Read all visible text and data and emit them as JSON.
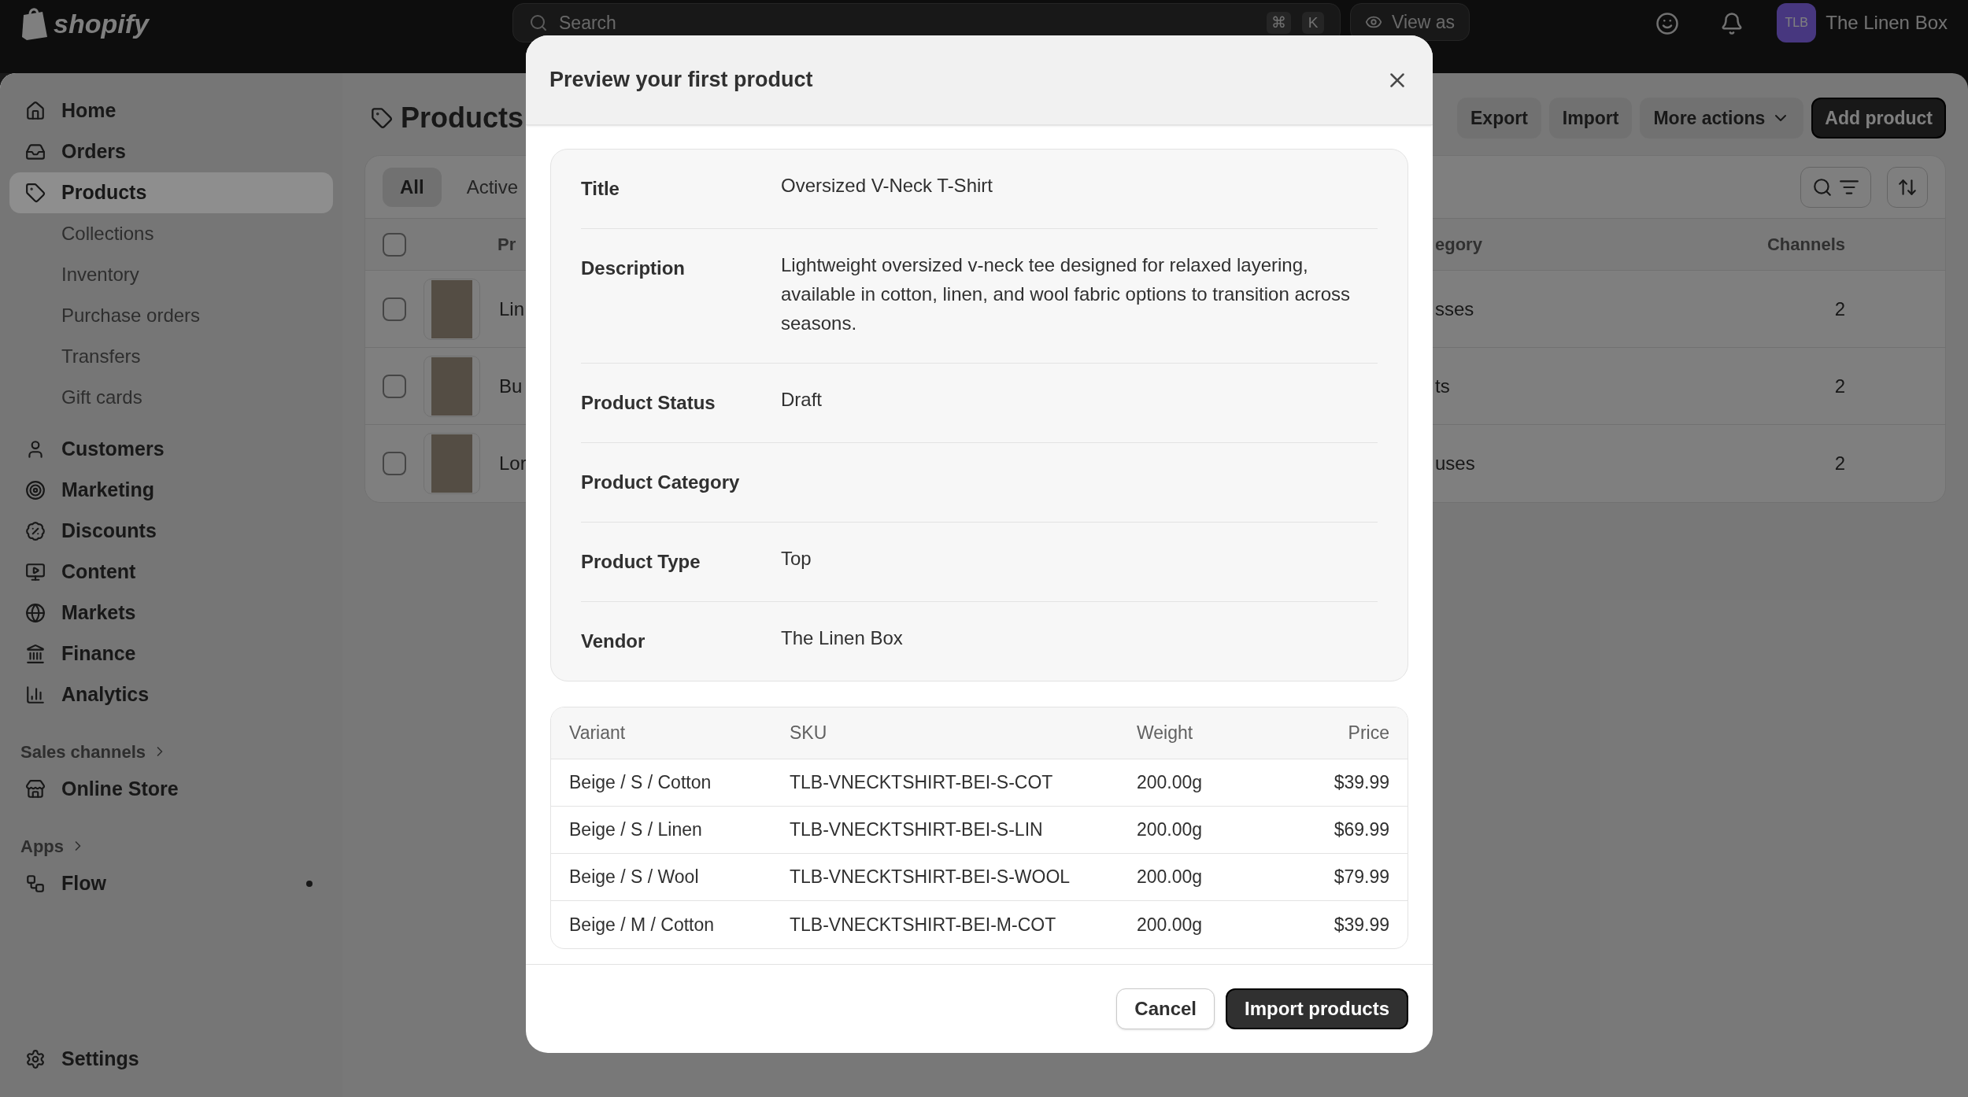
{
  "top_bar": {
    "logo_text": "shopify",
    "search": {
      "placeholder": "Search",
      "keys": [
        "⌘",
        "K"
      ]
    },
    "view_as": "View as",
    "store": {
      "initials": "TLB",
      "name": "The Linen Box"
    }
  },
  "sidebar": {
    "sections": [
      {
        "items": [
          {
            "label": "Home",
            "selected": false
          },
          {
            "label": "Orders",
            "selected": false
          },
          {
            "label": "Products",
            "selected": true,
            "children": [
              {
                "label": "Collections",
                "selected": false
              },
              {
                "label": "Inventory",
                "selected": false
              },
              {
                "label": "Purchase orders",
                "selected": false
              },
              {
                "label": "Transfers",
                "selected": false
              },
              {
                "label": "Gift cards",
                "selected": false
              }
            ]
          },
          {
            "label": "Customers",
            "selected": false
          },
          {
            "label": "Marketing",
            "selected": false
          },
          {
            "label": "Discounts",
            "selected": false
          },
          {
            "label": "Content",
            "selected": false
          },
          {
            "label": "Markets",
            "selected": false
          },
          {
            "label": "Finance",
            "selected": false
          },
          {
            "label": "Analytics",
            "selected": false
          }
        ]
      },
      {
        "heading": "Sales channels",
        "items": [
          {
            "label": "Online Store",
            "selected": false
          }
        ]
      },
      {
        "heading": "Apps",
        "items": [
          {
            "label": "Flow",
            "selected": false,
            "has_update": true
          }
        ]
      }
    ],
    "footer_item": {
      "label": "Settings"
    }
  },
  "page": {
    "title": "Products",
    "actions": [
      {
        "label": "Export",
        "kind": "secondary"
      },
      {
        "label": "Import",
        "kind": "secondary"
      },
      {
        "label": "More actions",
        "kind": "menu"
      },
      {
        "label": "Add product",
        "kind": "primary"
      }
    ],
    "tabs": [
      {
        "label": "All",
        "selected": true
      },
      {
        "label": "Active",
        "selected": false
      }
    ],
    "table": {
      "select_all_checked": false,
      "columns": [
        "Pr",
        "egory",
        "Channels"
      ],
      "rows": [
        {
          "checked": false,
          "product": "Lin",
          "category": "sses",
          "channels": "2"
        },
        {
          "checked": false,
          "product": "Bu",
          "category": "ts",
          "channels": "2"
        },
        {
          "checked": false,
          "product": "Lor",
          "category": "uses",
          "channels": "2"
        }
      ]
    }
  },
  "modal": {
    "title": "Preview your first product",
    "details": [
      {
        "label": "Title",
        "value": "Oversized V-Neck T-Shirt"
      },
      {
        "label": "Description",
        "value": "Lightweight oversized v-neck tee designed for relaxed layering, available in cotton, linen, and wool fabric options to transition across seasons."
      },
      {
        "label": "Product Status",
        "value": "Draft"
      },
      {
        "label": "Product Category"
      },
      {
        "label": "Product Type",
        "value": "Top"
      },
      {
        "label": "Vendor",
        "value": "The Linen Box"
      }
    ],
    "variants": {
      "columns": [
        "Variant",
        "SKU",
        "Weight",
        "Price"
      ],
      "rows": [
        [
          "Beige / S / Cotton",
          "TLB-VNECKTSHIRT-BEI-S-COT",
          "200.00g",
          "$39.99"
        ],
        [
          "Beige / S / Linen",
          "TLB-VNECKTSHIRT-BEI-S-LIN",
          "200.00g",
          "$69.99"
        ],
        [
          "Beige / S / Wool",
          "TLB-VNECKTSHIRT-BEI-S-WOOL",
          "200.00g",
          "$79.99"
        ],
        [
          "Beige / M / Cotton",
          "TLB-VNECKTSHIRT-BEI-M-COT",
          "200.00g",
          "$39.99"
        ]
      ]
    },
    "buttons": {
      "cancel": "Cancel",
      "confirm": "Import products"
    }
  }
}
